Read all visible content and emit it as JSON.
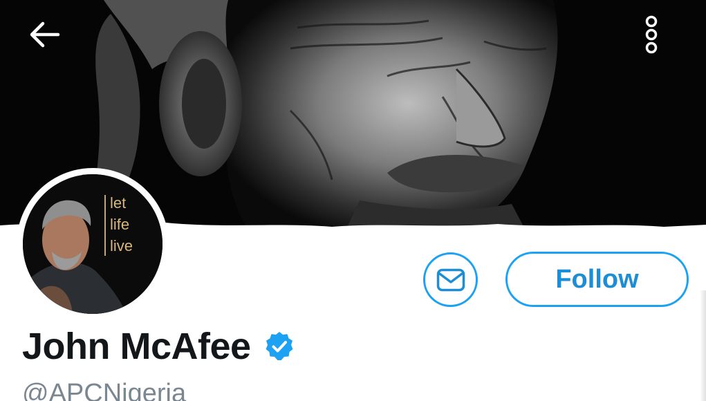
{
  "profile": {
    "display_name": "John McAfee",
    "handle": "@APCNigeria",
    "verified": true
  },
  "avatar": {
    "overlay_lines": [
      "let",
      "life",
      "live"
    ]
  },
  "actions": {
    "follow_label": "Follow"
  },
  "icons": {
    "back": "arrow-left-icon",
    "more": "vertical-ellipsis-icon",
    "message": "envelope-icon",
    "verified": "verified-badge-icon"
  },
  "colors": {
    "accent": "#1da1f2",
    "name_text": "#14171a",
    "handle_text": "#7a8791",
    "banner_bg": "#050505",
    "avatar_text": "#d9b77a"
  }
}
